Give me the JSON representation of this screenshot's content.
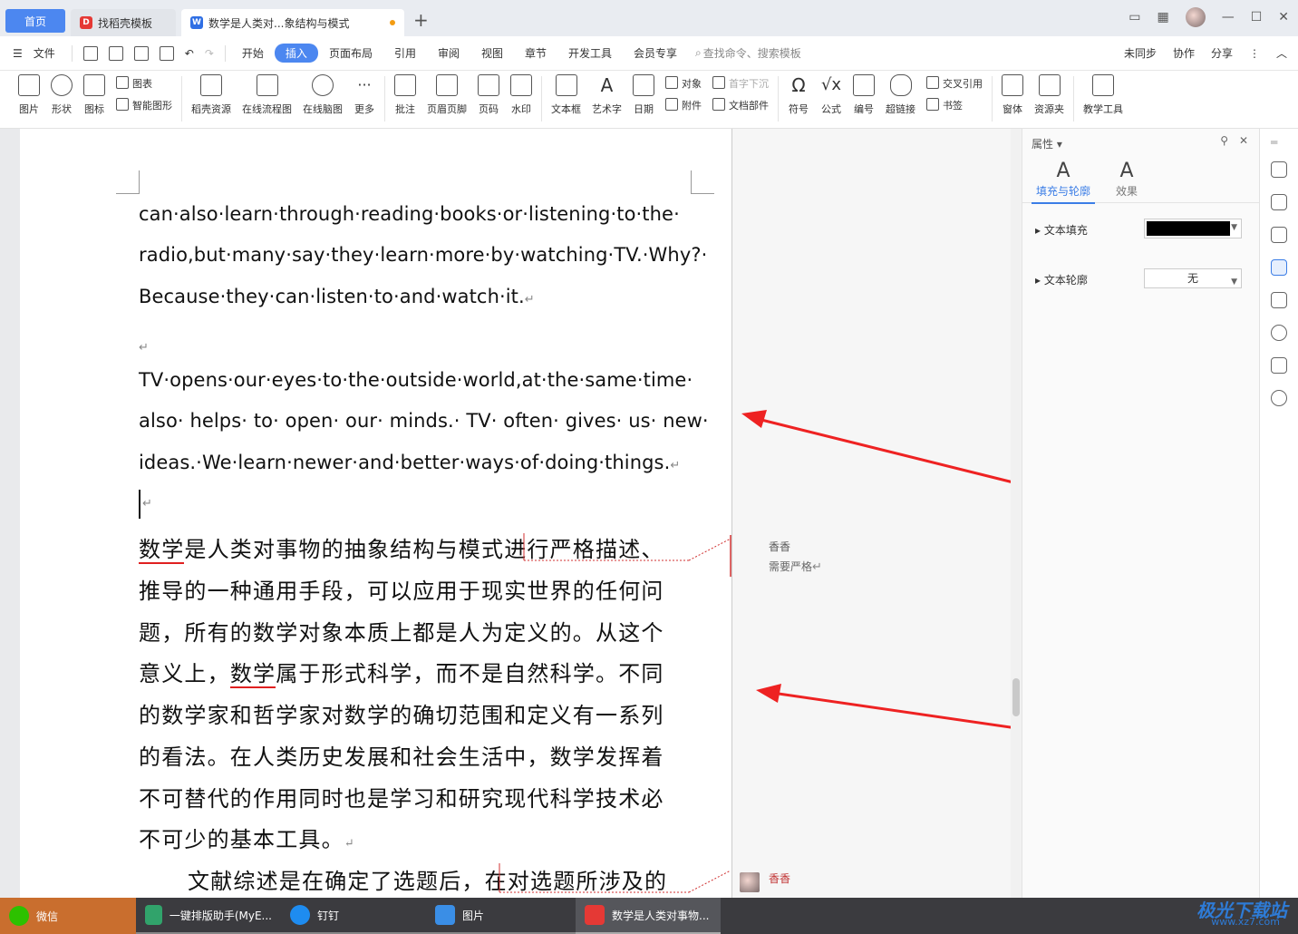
{
  "titlebar": {
    "tabs": [
      {
        "label": "首页"
      },
      {
        "label": "找稻壳模板"
      },
      {
        "label": "数学是人类对...象结构与模式"
      }
    ]
  },
  "menubar": {
    "file": "文件",
    "items": [
      "开始",
      "插入",
      "页面布局",
      "引用",
      "审阅",
      "视图",
      "章节",
      "开发工具",
      "会员专享"
    ],
    "active": "插入",
    "search": "查找命令、搜索模板",
    "right": [
      "未同步",
      "协作",
      "分享"
    ]
  },
  "ribbon": {
    "big": [
      {
        "label": "图片",
        "icon": "image-icon"
      },
      {
        "label": "形状",
        "icon": "shapes-icon"
      },
      {
        "label": "图标",
        "icon": "icons-icon"
      }
    ],
    "pair1": [
      "图表",
      "智能图形"
    ],
    "group2": [
      {
        "label": "稻壳资源"
      },
      {
        "label": "在线流程图"
      },
      {
        "label": "在线脑图"
      },
      {
        "label": "更多"
      }
    ],
    "group3": [
      {
        "label": "批注"
      },
      {
        "label": "页眉页脚"
      },
      {
        "label": "页码"
      },
      {
        "label": "水印"
      }
    ],
    "group4": [
      {
        "label": "文本框"
      },
      {
        "label": "艺术字"
      },
      {
        "label": "日期"
      }
    ],
    "pair2": [
      "对象",
      "附件"
    ],
    "pair3": [
      "首字下沉",
      "文档部件"
    ],
    "group5": [
      {
        "label": "符号"
      },
      {
        "label": "公式"
      },
      {
        "label": "编号"
      },
      {
        "label": "超链接"
      }
    ],
    "pair4": [
      "交叉引用",
      "书签"
    ],
    "group6": [
      {
        "label": "窗体"
      },
      {
        "label": "资源夹"
      },
      {
        "label": "教学工具"
      }
    ]
  },
  "document": {
    "en_lines": [
      "can·also·learn·through·reading·books·or·listening·to·the·",
      "radio,but·many·say·they·learn·more·by·watching·TV.·Why?·",
      "Because·they·can·listen·to·and·watch·it.",
      "",
      "TV·opens·our·eyes·to·the·outside·world,at·the·same·time·",
      "also· helps· to· open· our· minds.· TV· often· gives· us· new·",
      "ideas.·We·learn·newer·and·better·ways·of·doing·things."
    ],
    "zh_lines": [
      {
        "pre": "",
        "u": "数学",
        "post": "是人类对事物的抽象结构与模式进行严格描述、"
      },
      {
        "pre": "推导的一种通用手段，可以应用于现实世界的任何问",
        "u": "",
        "post": ""
      },
      {
        "pre": "题，所有的数学对象本质上都是人为定义的。从这个",
        "u": "",
        "post": ""
      },
      {
        "pre": "意义上，",
        "u": "数学",
        "post": "属于形式科学，而不是自然科学。不同"
      },
      {
        "pre": "的数学家和哲学家对数学的确切范围和定义有一系列",
        "u": "",
        "post": ""
      },
      {
        "pre": "的看法。在人类历史发展和社会生活中，数学发挥着",
        "u": "",
        "post": ""
      },
      {
        "pre": "不可替代的作用同时也是学习和研究现代科学技术必",
        "u": "",
        "post": ""
      },
      {
        "pre": "不可少的基本工具。",
        "u": "",
        "post": ""
      }
    ],
    "zh_last": "文献综述是在确定了选题后，在对选题所涉及的"
  },
  "comments": [
    {
      "author": "香香",
      "text": "需要严格"
    },
    {
      "author": "香香"
    }
  ],
  "properties": {
    "title": "属性",
    "tab_fill": "填充与轮廓",
    "tab_effect": "效果",
    "text_fill": "文本填充",
    "text_outline": "文本轮廓",
    "outline_value": "无",
    "fill_color": "#000000"
  },
  "taskbar": [
    {
      "label": "微信"
    },
    {
      "label": "一键排版助手(MyE..."
    },
    {
      "label": "钉钉"
    },
    {
      "label": "图片"
    },
    {
      "label": "数学是人类对事物..."
    }
  ],
  "watermark": "极光下载站",
  "watermark_sub": "www.xz7.com",
  "colors": {
    "accent": "#4c87f0",
    "arrow": "#ee2222"
  }
}
